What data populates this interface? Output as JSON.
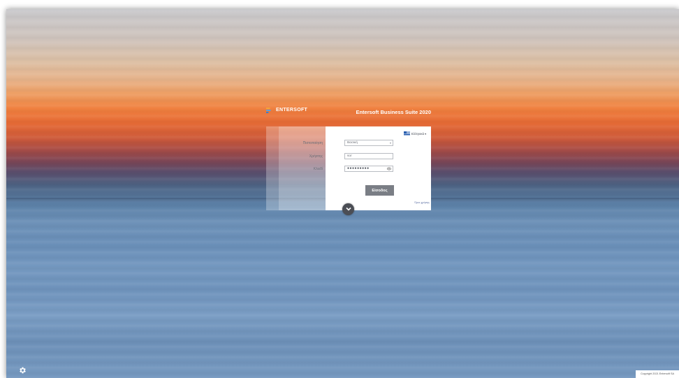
{
  "brand": {
    "logo_text": "ENTERSOFT",
    "suite_title": "Entersoft Business Suite 2020"
  },
  "login": {
    "language": "Ελληνικά",
    "company_label": "Πιστοποίηση",
    "company_value": "Βασική",
    "user_label": "Χρήστης",
    "user_value": "sor",
    "password_label": "Κλειδί",
    "password_value": "●●●●●●●●●",
    "submit_label": "Είσοδος",
    "terms_label": "Όροι χρήσης"
  },
  "footer": {
    "copyright": "Copyright 2021 Entersoft SA"
  },
  "icons": {
    "settings": "gear-icon",
    "expand": "chevron-down-icon",
    "show_password": "eye-icon",
    "language_flag": "greek-flag-icon"
  },
  "colors": {
    "button": "#7a7e85",
    "expand_button": "#4b4e55",
    "panel": "#ffffff"
  }
}
